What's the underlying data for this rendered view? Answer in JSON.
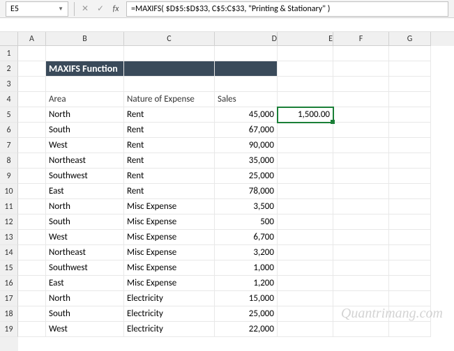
{
  "nameBox": "E5",
  "formula": "=MAXIFS( $D$5:$D$33, C$5:C$33, \"Printing & Stationary\" )",
  "columns": [
    "A",
    "B",
    "C",
    "D",
    "E",
    "F",
    "G"
  ],
  "rowNumbers": [
    1,
    2,
    3,
    4,
    5,
    6,
    7,
    8,
    9,
    10,
    11,
    12,
    13,
    14,
    15,
    16,
    17,
    18,
    19
  ],
  "title": "MAXIFS Function",
  "headers": {
    "area": "Area",
    "nature": "Nature of Expense",
    "sales": "Sales"
  },
  "selectedValue": "1,500.00",
  "rows": [
    {
      "area": "North",
      "nature": "Rent",
      "sales": "45,000"
    },
    {
      "area": "South",
      "nature": "Rent",
      "sales": "67,000"
    },
    {
      "area": "West",
      "nature": "Rent",
      "sales": "90,000"
    },
    {
      "area": "Northeast",
      "nature": "Rent",
      "sales": "35,000"
    },
    {
      "area": "Southwest",
      "nature": "Rent",
      "sales": "25,000"
    },
    {
      "area": "East",
      "nature": "Rent",
      "sales": "78,000"
    },
    {
      "area": "North",
      "nature": "Misc Expense",
      "sales": "3,500"
    },
    {
      "area": "South",
      "nature": "Misc Expense",
      "sales": "500"
    },
    {
      "area": "West",
      "nature": "Misc Expense",
      "sales": "6,700"
    },
    {
      "area": "Northeast",
      "nature": "Misc Expense",
      "sales": "3,200"
    },
    {
      "area": "Southwest",
      "nature": "Misc Expense",
      "sales": "1,000"
    },
    {
      "area": "East",
      "nature": "Misc Expense",
      "sales": "1,200"
    },
    {
      "area": "North",
      "nature": "Electricity",
      "sales": "15,000"
    },
    {
      "area": "South",
      "nature": "Electricity",
      "sales": "25,000"
    },
    {
      "area": "West",
      "nature": "Electricity",
      "sales": "22,000"
    }
  ],
  "watermark": "Quantrimang.com"
}
